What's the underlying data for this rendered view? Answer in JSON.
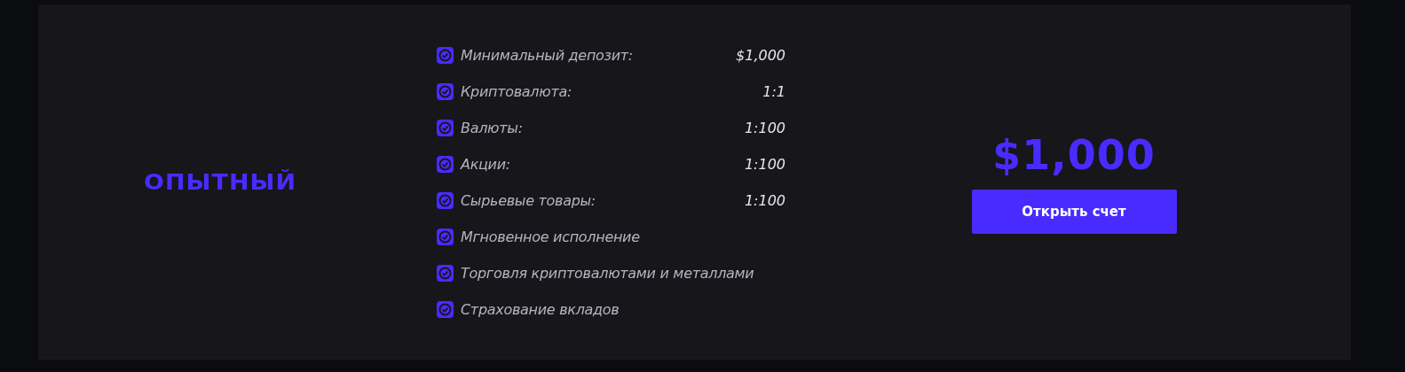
{
  "plan": {
    "name": "ОПЫТНЫЙ",
    "features": [
      {
        "label": "Минимальный депозит:",
        "value": "$1,000",
        "checked": true
      },
      {
        "label": "Криптовалюта:",
        "value": "1:1",
        "checked": true
      },
      {
        "label": "Валюты:",
        "value": "1:100",
        "checked": true
      },
      {
        "label": "Акции:",
        "value": "1:100",
        "checked": true
      },
      {
        "label": "Сырьевые товары:",
        "value": "1:100",
        "checked": true
      },
      {
        "label": "Мгновенное исполнение",
        "checked": true
      },
      {
        "label": "Торговля криптовалютами и металлами",
        "checked": true
      },
      {
        "label": "Страхование вкладов",
        "checked": true
      }
    ],
    "price": "$1,000",
    "button": "Открыть счет"
  }
}
